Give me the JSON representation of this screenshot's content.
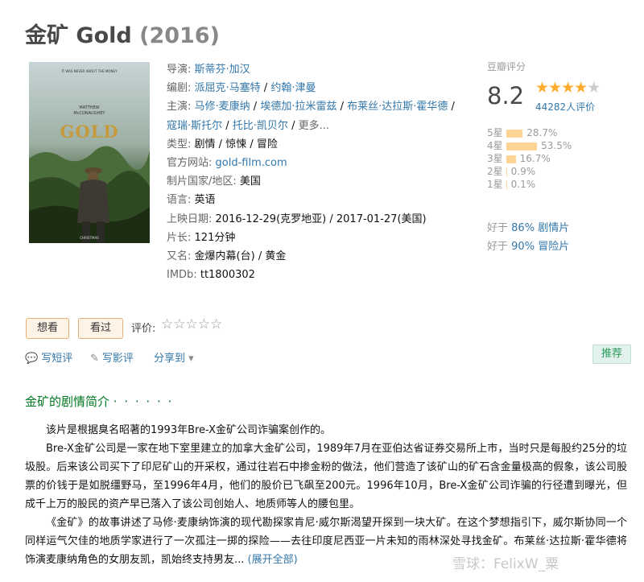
{
  "movie": {
    "title_cn": "金矿",
    "title_en": "Gold",
    "year": "(2016)"
  },
  "poster": {
    "tagline": "IT WAS NEVER ABOUT THE MONEY",
    "actor_line1": "MATTHEW",
    "actor_line2": "McCONAUGHEY",
    "title": "GOLD",
    "release": "CHRISTMAS"
  },
  "info": {
    "director_label": "导演:",
    "director": "斯蒂芬·加汉",
    "writer_label": "编剧:",
    "writer_1": "派屈克·马塞特",
    "writer_2": "约翰·津曼",
    "cast_label": "主演:",
    "cast_1": "马修·麦康纳",
    "cast_2": "埃德加·拉米雷兹",
    "cast_3": "布莱丝·达拉斯·霍华德",
    "cast_4": "寇瑞·斯托尔",
    "cast_5": "托比·凯贝尔",
    "cast_more": "更多...",
    "sep": " / ",
    "genre_label": "类型:",
    "genre_1": "剧情",
    "genre_2": "惊悚",
    "genre_3": "冒险",
    "site_label": "官方网站:",
    "site": "gold-film.com",
    "country_label": "制片国家/地区:",
    "country": "美国",
    "lang_label": "语言:",
    "lang": "英语",
    "release_label": "上映日期:",
    "release_1": "2016-12-29(克罗地亚)",
    "release_2": "2017-01-27(美国)",
    "runtime_label": "片长:",
    "runtime": "121分钟",
    "aka_label": "又名:",
    "aka_1": "金爆内幕(台)",
    "aka_2": "黄金",
    "imdb_label": "IMDb:",
    "imdb": "tt1800302"
  },
  "rating": {
    "label": "豆瓣评分",
    "score": "8.2",
    "stars_filled": 4,
    "count": "44282人评价",
    "dist": [
      {
        "label": "5星",
        "pct": 28.7,
        "pct_text": "28.7%"
      },
      {
        "label": "4星",
        "pct": 53.5,
        "pct_text": "53.5%"
      },
      {
        "label": "3星",
        "pct": 16.7,
        "pct_text": "16.7%"
      },
      {
        "label": "2星",
        "pct": 0.9,
        "pct_text": "0.9%"
      },
      {
        "label": "1星",
        "pct": 0.1,
        "pct_text": "0.1%"
      }
    ],
    "better_prefix": "好于",
    "better_1_pct": "86%",
    "better_1_genre": "剧情片",
    "better_2_pct": "90%",
    "better_2_genre": "冒险片"
  },
  "actions": {
    "want": "想看",
    "seen": "看过",
    "rate_label": "评价:",
    "rate_stars": "☆☆☆☆☆",
    "short_review": "写短评",
    "review": "写影评",
    "share": "分享到",
    "recommend": "推荐"
  },
  "summary": {
    "title": "金矿的剧情简介",
    "dots": "· · · · · ·",
    "p1": "该片是根据臭名昭著的1993年Bre-X金矿公司诈骗案创作的。",
    "p2": "Bre-X金矿公司是一家在地下室里建立的加拿大金矿公司，1989年7月在亚伯达省证券交易所上市，当时只是每股约25分的垃圾股。后来该公司买下了印尼矿山的开采权，通过往岩石中掺金粉的做法，他们营造了该矿山的矿石含金量极高的假象，该公司股票的价钱于是如脱缰野马，至1996年4月，他们的股价已飞飙至200元。1996年10月，Bre-X金矿公司诈骗的行径遭到曝光，但成千上万的股民的资产早已落入了该公司创始人、地质师等人的腰包里。",
    "p3": "《金矿》的故事讲述了马修·麦康纳饰演的现代勘探家肯尼·威尔斯渴望开探到一块大矿。在这个梦想指引下，威尔斯协同一个同样运气欠佳的地质学家进行了一次孤注一掷的探险——去往印度尼西亚一片未知的雨林深处寻找金矿。布莱丝·达拉斯·霍华德将饰演麦康纳角色的女朋友凯，凯始终支持男友...",
    "expand": "(展开全部)"
  },
  "watermark": "雪球：FelixW_粟",
  "colors": {
    "link": "#3377aa",
    "green": "#007722",
    "star": "#ffac2d",
    "bar": "#ffd596"
  }
}
